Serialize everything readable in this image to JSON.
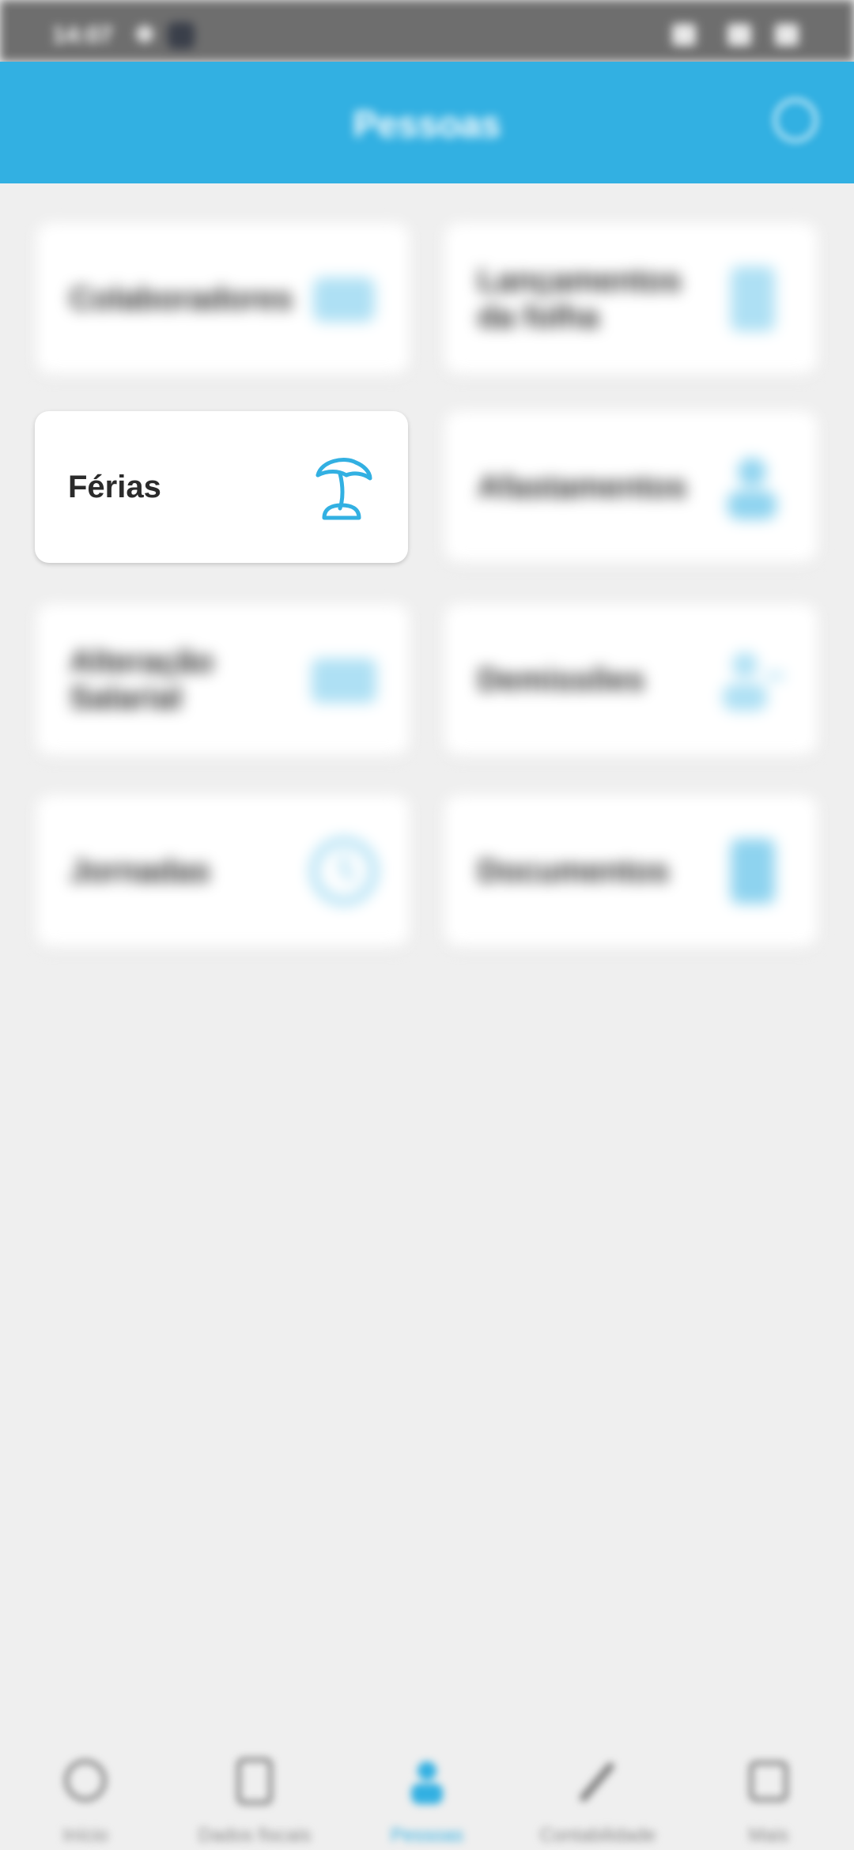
{
  "status_bar": {
    "time": "14:07"
  },
  "header": {
    "title": "Pessoas"
  },
  "cards": [
    {
      "label": "Colaboradores",
      "icon": "people-icon"
    },
    {
      "label": "Lançamentos da folha",
      "icon": "document-icon"
    },
    {
      "label": "Férias",
      "icon": "palm-tree-icon"
    },
    {
      "label": "Afastamentos",
      "icon": "person-icon"
    },
    {
      "label": "Alteração Salarial",
      "icon": "money-icon"
    },
    {
      "label": "Demissões",
      "icon": "person-remove-icon"
    },
    {
      "label": "Jornadas",
      "icon": "clock-icon"
    },
    {
      "label": "Documentos",
      "icon": "file-icon"
    }
  ],
  "bottom_nav": [
    {
      "label": "Início",
      "icon": "home-icon"
    },
    {
      "label": "Dados fiscais",
      "icon": "folder-icon"
    },
    {
      "label": "Pessoas",
      "icon": "person-icon",
      "active": true
    },
    {
      "label": "Contabilidade",
      "icon": "pencil-icon"
    },
    {
      "label": "Mais",
      "icon": "grid-icon"
    }
  ],
  "colors": {
    "accent": "#32b0e2",
    "background": "#efefef",
    "card": "#ffffff",
    "text": "#2b2b2b"
  }
}
